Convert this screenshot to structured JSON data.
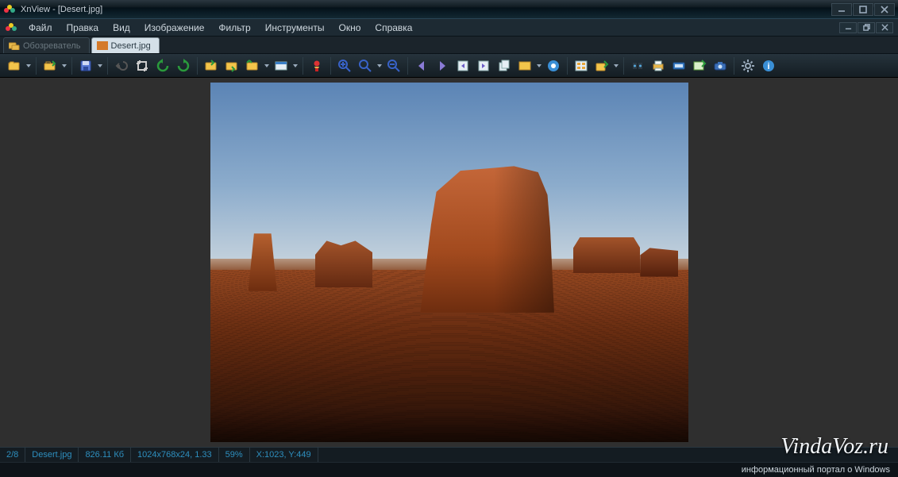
{
  "window": {
    "title": "XnView - [Desert.jpg]"
  },
  "menu": {
    "items": [
      "Файл",
      "Правка",
      "Вид",
      "Изображение",
      "Фильтр",
      "Инструменты",
      "Окно",
      "Справка"
    ]
  },
  "tabs": {
    "browser_label": "Обозреватель",
    "active_label": "Desert.jpg"
  },
  "toolbar_icons": [
    "browse-open",
    "open-file",
    "save",
    "undo",
    "crop",
    "rotate-ccw",
    "rotate-cw",
    "flip-h",
    "flip-v",
    "resize",
    "canvas-size",
    "red-eye",
    "zoom-in",
    "zoom-fit",
    "zoom-out",
    "prev",
    "next",
    "first",
    "last",
    "slideshow",
    "fullscreen",
    "thumbnails",
    "export",
    "batch-convert",
    "print",
    "scan",
    "copy-to",
    "camera",
    "settings",
    "about"
  ],
  "status": {
    "index": "2/8",
    "filename": "Desert.jpg",
    "size": "826.11 Кб",
    "dimensions": "1024x768x24, 1.33",
    "zoom": "59%",
    "cursor": "X:1023, Y:449"
  },
  "watermark": {
    "big": "VindaVoz.ru",
    "small": "информационный портал о Windows"
  }
}
